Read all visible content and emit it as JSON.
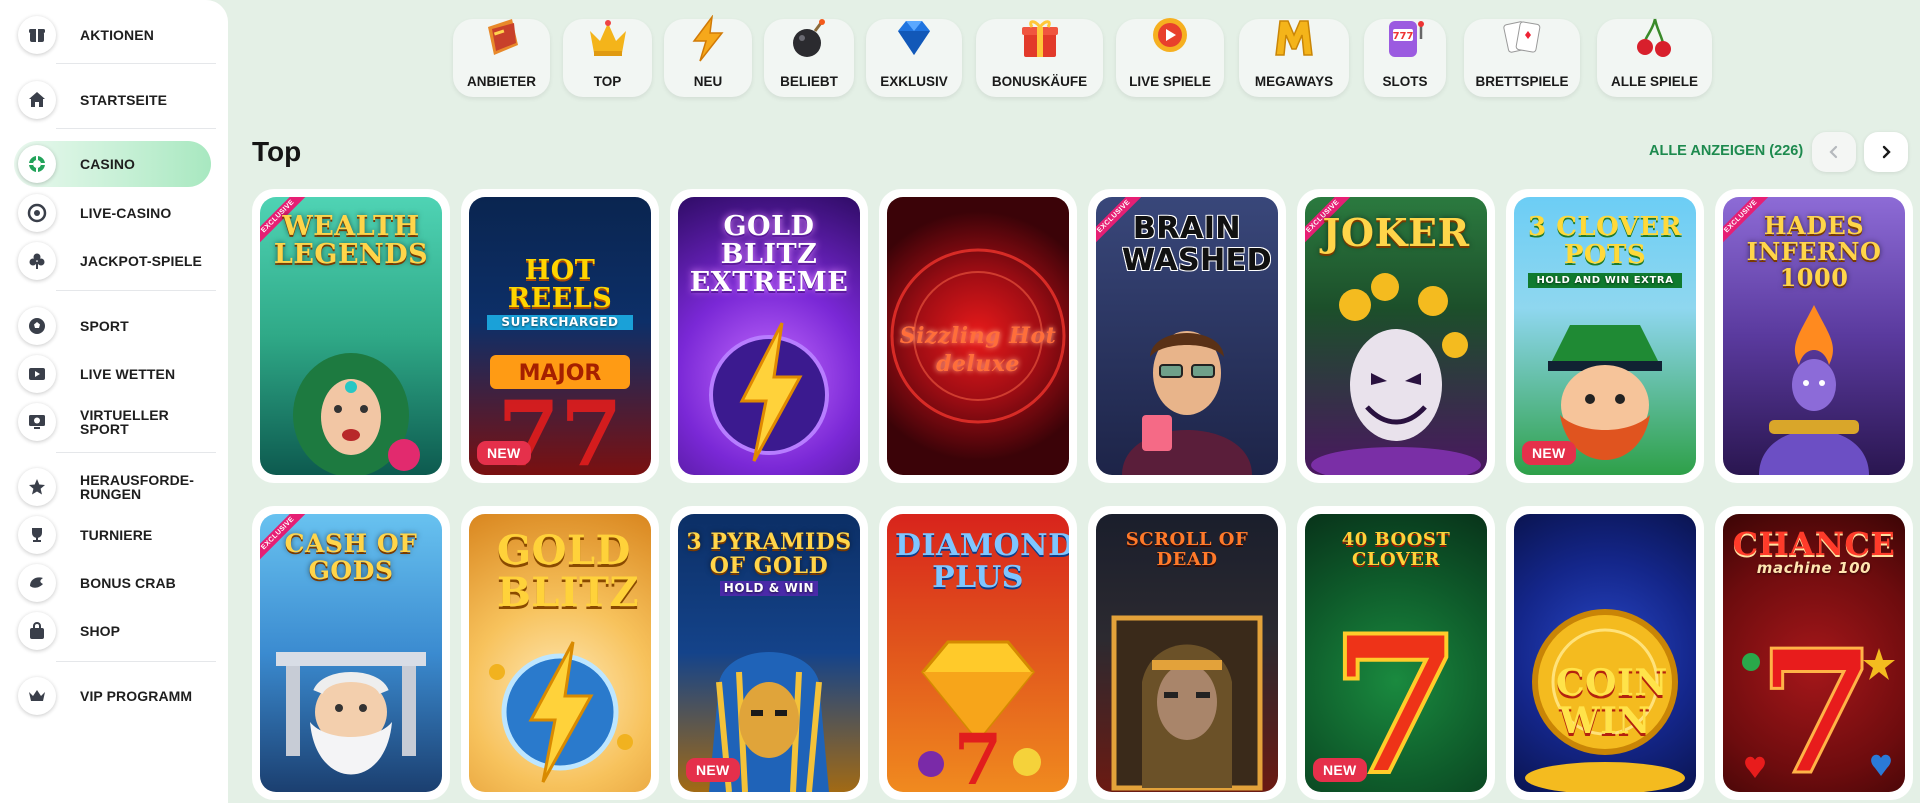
{
  "sidebar": {
    "items": [
      {
        "label": "AKTIONEN",
        "icon": "gift-box-icon"
      },
      {
        "label": "STARTSEITE",
        "icon": "home-icon"
      },
      {
        "label": "CASINO",
        "icon": "casino-chip-icon",
        "active": true
      },
      {
        "label": "LIVE-CASINO",
        "icon": "roulette-icon"
      },
      {
        "label": "JACKPOT-SPIELE",
        "icon": "clover-icon"
      },
      {
        "label": "SPORT",
        "icon": "soccer-ball-icon"
      },
      {
        "label": "LIVE WETTEN",
        "icon": "play-screen-icon"
      },
      {
        "label": "VIRTUELLER SPORT",
        "icon": "monitor-ball-icon"
      },
      {
        "label": "HERAUSFORDE-RUNGEN",
        "label_line1": "HERAUSFORDE-",
        "label_line2": "RUNGEN",
        "icon": "star-badge-icon"
      },
      {
        "label": "TURNIERE",
        "icon": "trophy-icon"
      },
      {
        "label": "BONUS CRAB",
        "icon": "crab-claw-icon"
      },
      {
        "label": "SHOP",
        "icon": "shopping-bag-icon"
      },
      {
        "label": "VIP PROGRAMM",
        "icon": "crown-icon"
      }
    ]
  },
  "categories": [
    {
      "label": "ANBIETER",
      "icon": "book-icon"
    },
    {
      "label": "TOP",
      "icon": "crown-icon"
    },
    {
      "label": "NEU",
      "icon": "lightning-icon"
    },
    {
      "label": "BELIEBT",
      "icon": "bomb-icon"
    },
    {
      "label": "EXKLUSIV",
      "icon": "diamond-icon"
    },
    {
      "label": "BONUSKÄUFE",
      "icon": "gift-icon"
    },
    {
      "label": "LIVE SPIELE",
      "icon": "live-play-icon"
    },
    {
      "label": "MEGAWAYS",
      "icon": "letter-m-icon"
    },
    {
      "label": "SLOTS",
      "icon": "slot-machine-icon"
    },
    {
      "label": "BRETTSPIELE",
      "icon": "playing-cards-icon"
    },
    {
      "label": "ALLE SPIELE",
      "icon": "cherries-icon"
    }
  ],
  "section": {
    "title": "Top",
    "show_all": "ALLE ANZEIGEN (226)"
  },
  "games_row1": [
    {
      "title": "WEALTH LEGENDS",
      "sub": "",
      "ribbon": "EXCLUSIVE",
      "badge": "",
      "bg1": "#36c7a8",
      "bg2": "#0c6b60"
    },
    {
      "title": "HOT REELS",
      "sub": "SUPERCHARGED",
      "ribbon": "",
      "badge": "NEW",
      "bg1": "#0a2f66",
      "bg2": "#c11d1d"
    },
    {
      "title": "GOLD BLITZ EXTREME",
      "sub": "",
      "ribbon": "",
      "badge": "",
      "bg1": "#7d2ad8",
      "bg2": "#33106e"
    },
    {
      "title": "Sizzling Hot deluxe",
      "sub": "",
      "ribbon": "",
      "badge": "",
      "bg1": "#c0161e",
      "bg2": "#3a0409"
    },
    {
      "title": "BRAIN WASHED",
      "sub": "",
      "ribbon": "EXCLUSIVE",
      "badge": "",
      "bg1": "#3a4a7a",
      "bg2": "#141a36"
    },
    {
      "title": "JOKER",
      "sub": "",
      "ribbon": "EXCLUSIVE",
      "badge": "",
      "bg1": "#1f6b3a",
      "bg2": "#3b1550"
    },
    {
      "title": "3 CLOVER POTS",
      "sub": "HOLD AND WIN EXTRA",
      "ribbon": "",
      "badge": "NEW",
      "bg1": "#5ac1f0",
      "bg2": "#1e8a35"
    },
    {
      "title": "HADES INFERNO 1000",
      "sub": "",
      "ribbon": "EXCLUSIVE",
      "badge": "",
      "bg1": "#7a4bc8",
      "bg2": "#2c1552"
    }
  ],
  "games_row2": [
    {
      "title": "CASH OF GODS",
      "sub": "",
      "ribbon": "EXCLUSIVE",
      "badge": "",
      "bg1": "#4fb3ea",
      "bg2": "#1a4c82"
    },
    {
      "title": "GOLD BLITZ",
      "sub": "",
      "ribbon": "",
      "badge": "",
      "bg1": "#ffe2a3",
      "bg2": "#e08a1f"
    },
    {
      "title": "3 PYRAMIDS OF GOLD",
      "sub": "HOLD & WIN",
      "ribbon": "",
      "badge": "NEW",
      "bg1": "#0b3a78",
      "bg2": "#d79a1c"
    },
    {
      "title": "DIAMOND PLUS",
      "sub": "",
      "ribbon": "",
      "badge": "",
      "bg1": "#d9251c",
      "bg2": "#e88a1e"
    },
    {
      "title": "SCROLL OF DEAD",
      "sub": "",
      "ribbon": "",
      "badge": "",
      "bg1": "#1c2130",
      "bg2": "#6b1a12"
    },
    {
      "title": "40 BOOST CLOVER",
      "sub": "",
      "ribbon": "",
      "badge": "NEW",
      "bg1": "#0c5a2c",
      "bg2": "#0e3a1d"
    },
    {
      "title": "COIN WIN",
      "sub": "",
      "ribbon": "",
      "badge": "",
      "bg1": "#1736a3",
      "bg2": "#081552"
    },
    {
      "title": "CHANCE",
      "sub": "machine 100",
      "ribbon": "",
      "badge": "",
      "bg1": "#8d1414",
      "bg2": "#3d0505"
    }
  ],
  "colors": {
    "accent_green": "#1d8a4e",
    "new_badge": "#e5304b",
    "exclusive_ribbon": "#e61f74",
    "page_bg": "#e4f0e6"
  }
}
